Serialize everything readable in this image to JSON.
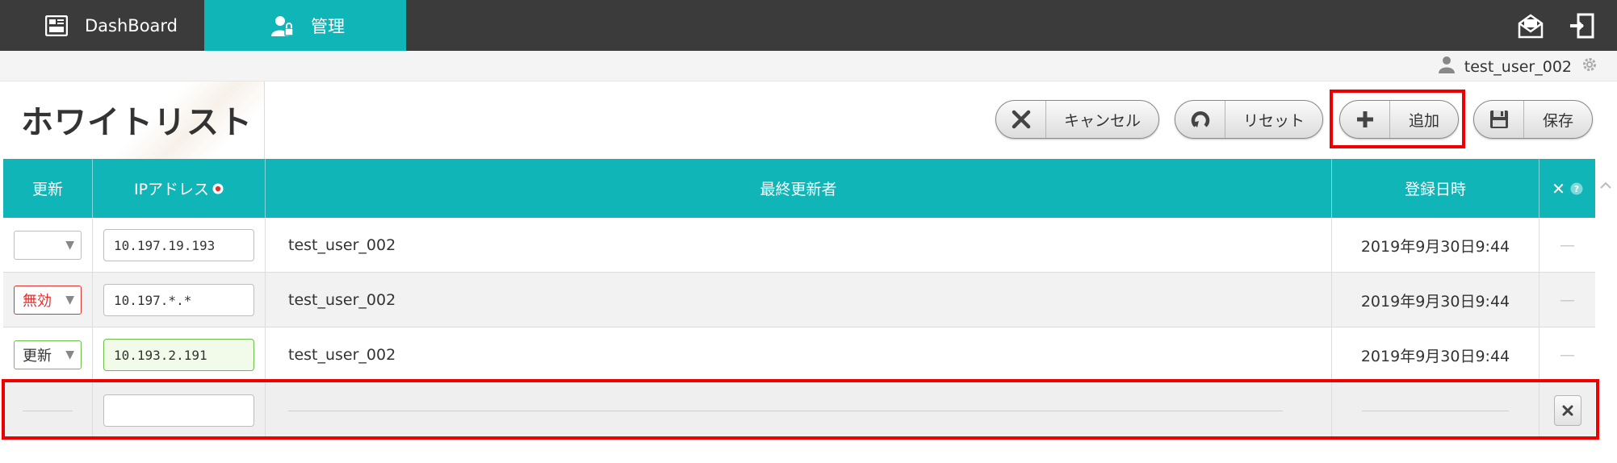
{
  "topbar": {
    "tabs": [
      {
        "label": "DashBoard",
        "icon": "dashboard-icon"
      },
      {
        "label": "管理",
        "icon": "user-admin-icon"
      }
    ],
    "right_icons": [
      "mail-icon",
      "logout-icon"
    ]
  },
  "user": {
    "name": "test_user_002",
    "icon": "person-icon",
    "settings_icon": "gear-icon"
  },
  "page": {
    "title": "ホワイトリスト"
  },
  "toolbar": {
    "cancel_label": "キャンセル",
    "reset_label": "リセット",
    "add_label": "追加",
    "save_label": "保存"
  },
  "table": {
    "headers": {
      "update": "更新",
      "ip": "IPアドレス",
      "last_updated_by": "最終更新者",
      "registered_at": "登録日時",
      "delete": "✕"
    },
    "rows": [
      {
        "status": "",
        "ip": "10.197.19.193",
        "user": "test_user_002",
        "date": "2019年9月30日9:44",
        "action": "—"
      },
      {
        "status": "無効",
        "ip": "10.197.*.*",
        "user": "test_user_002",
        "date": "2019年9月30日9:44",
        "action": "—"
      },
      {
        "status": "更新",
        "ip": "10.193.2.191",
        "user": "test_user_002",
        "date": "2019年9月30日9:44",
        "action": "—"
      }
    ]
  },
  "colors": {
    "accent": "#10b5b8",
    "topbar": "#3b3b3b",
    "highlight": "#ee0000",
    "invalid": "#e53030",
    "update": "#6cc04a"
  }
}
